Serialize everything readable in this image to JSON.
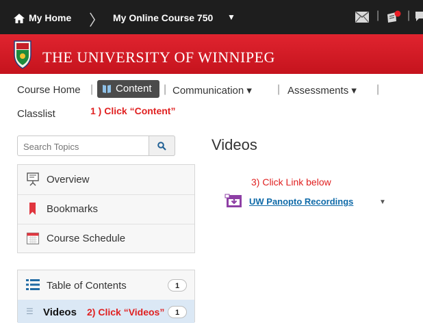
{
  "topbar": {
    "home_label": "My Home",
    "course_label": "My Online Course 750",
    "course_caret": "▼",
    "divider": "|"
  },
  "banner": {
    "title": "THE UNIVERSITY OF WINNIPEG"
  },
  "nav": {
    "items": [
      {
        "label": "Course Home"
      },
      {
        "label": "Content"
      },
      {
        "label": "Communication ▾"
      },
      {
        "label": "Assessments ▾"
      },
      {
        "label": "Classlist"
      }
    ],
    "separator": "|",
    "annotation": "1 ) Click “Content”"
  },
  "sidebar": {
    "search_placeholder": "Search Topics",
    "menu": [
      {
        "label": "Overview",
        "icon": "overview-icon"
      },
      {
        "label": "Bookmarks",
        "icon": "bookmark-icon"
      },
      {
        "label": "Course Schedule",
        "icon": "calendar-icon"
      }
    ],
    "toc_label": "Table of Contents",
    "toc_count": "1",
    "videos_label": "Videos",
    "videos_annotation": "2) Click “Videos”",
    "videos_count": "1"
  },
  "main": {
    "title": "Videos",
    "annotation": "3) Click Link below",
    "link_label": "UW Panopto Recordings",
    "link_caret": "▼"
  },
  "colors": {
    "topbar": "#1e1e1e",
    "banner": "#d41f29",
    "annotation": "#e02020",
    "link": "#0f6aa8",
    "selected_row": "#dbe8f5"
  }
}
